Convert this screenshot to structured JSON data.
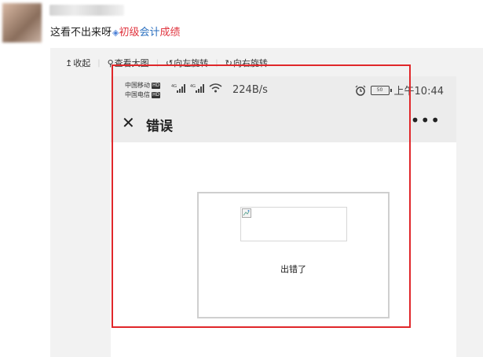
{
  "post": {
    "text": "这看不出来呀",
    "link_icon": "link-icon",
    "link_part1": "初级",
    "link_part2": "会计",
    "link_part3": "成绩"
  },
  "toolbar": {
    "collapse": "收起",
    "view_large": "查看大图",
    "rotate_left": "向左旋转",
    "rotate_right": "向右旋转"
  },
  "phone_status": {
    "carrier1": "中国移动",
    "carrier2": "中国电信",
    "hd": "HD",
    "net": "4G",
    "speed": "224B/s",
    "battery": "50",
    "time": "上午10:44"
  },
  "phone_page": {
    "title": "错误",
    "more": "•••",
    "error_message": "出错了"
  },
  "colors": {
    "highlight": "#e0272a",
    "link_red": "#e0353f",
    "link_blue": "#2a6fbf"
  }
}
